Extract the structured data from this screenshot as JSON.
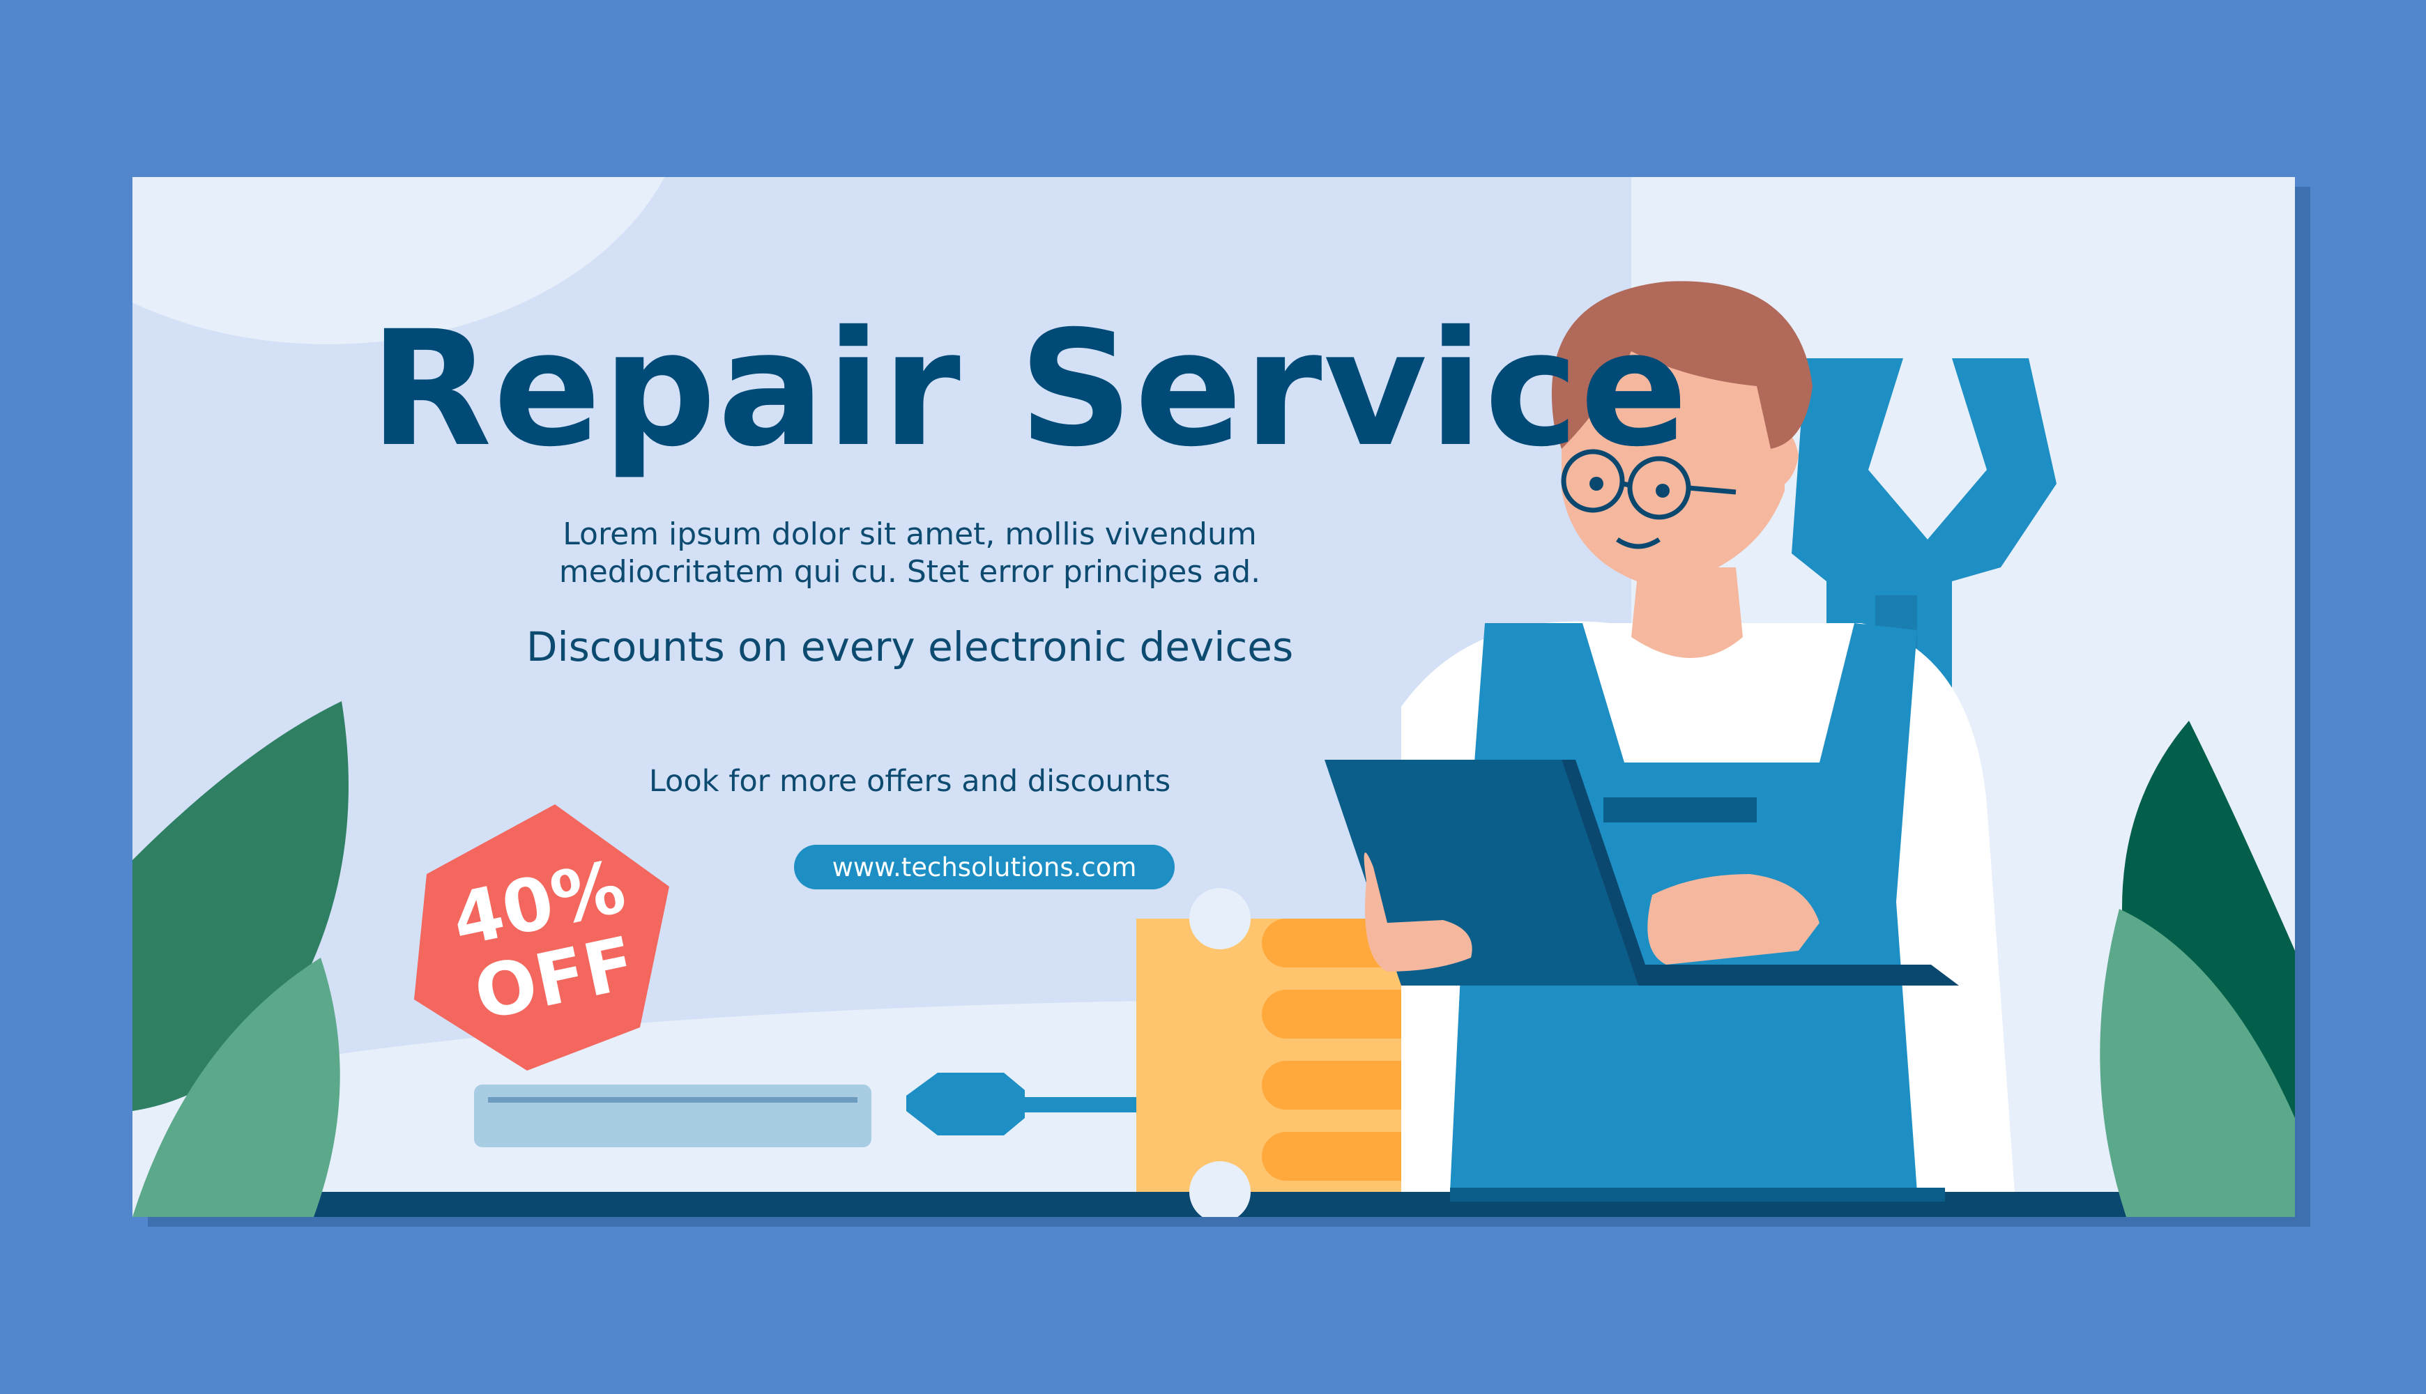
{
  "banner": {
    "title": "Repair Service",
    "description": "Lorem ipsum dolor sit amet, mollis vivendum mediocritatem qui cu. Stet error principes ad.",
    "subtitle": "Discounts on every electronic devices",
    "offers_text": "Look for more offers and discounts",
    "url": "www.techsolutions.com",
    "badge": {
      "percent": "40%",
      "off": "OFF"
    }
  },
  "icons": [
    "wrench-icon",
    "screwdriver-icon",
    "tablet-icon",
    "leaf-icon",
    "discount-badge-icon"
  ],
  "colors": {
    "page_background": "#5287CD",
    "banner_background": "#D3E0F6",
    "title": "#004A77",
    "badge": "#F3675E",
    "url_pill": "#1D8FC4",
    "overalls": "#1E8FC4",
    "leaf_dark": "#2F7F63",
    "leaf_light": "#5CA88A",
    "ruler": "#FFB84D"
  }
}
